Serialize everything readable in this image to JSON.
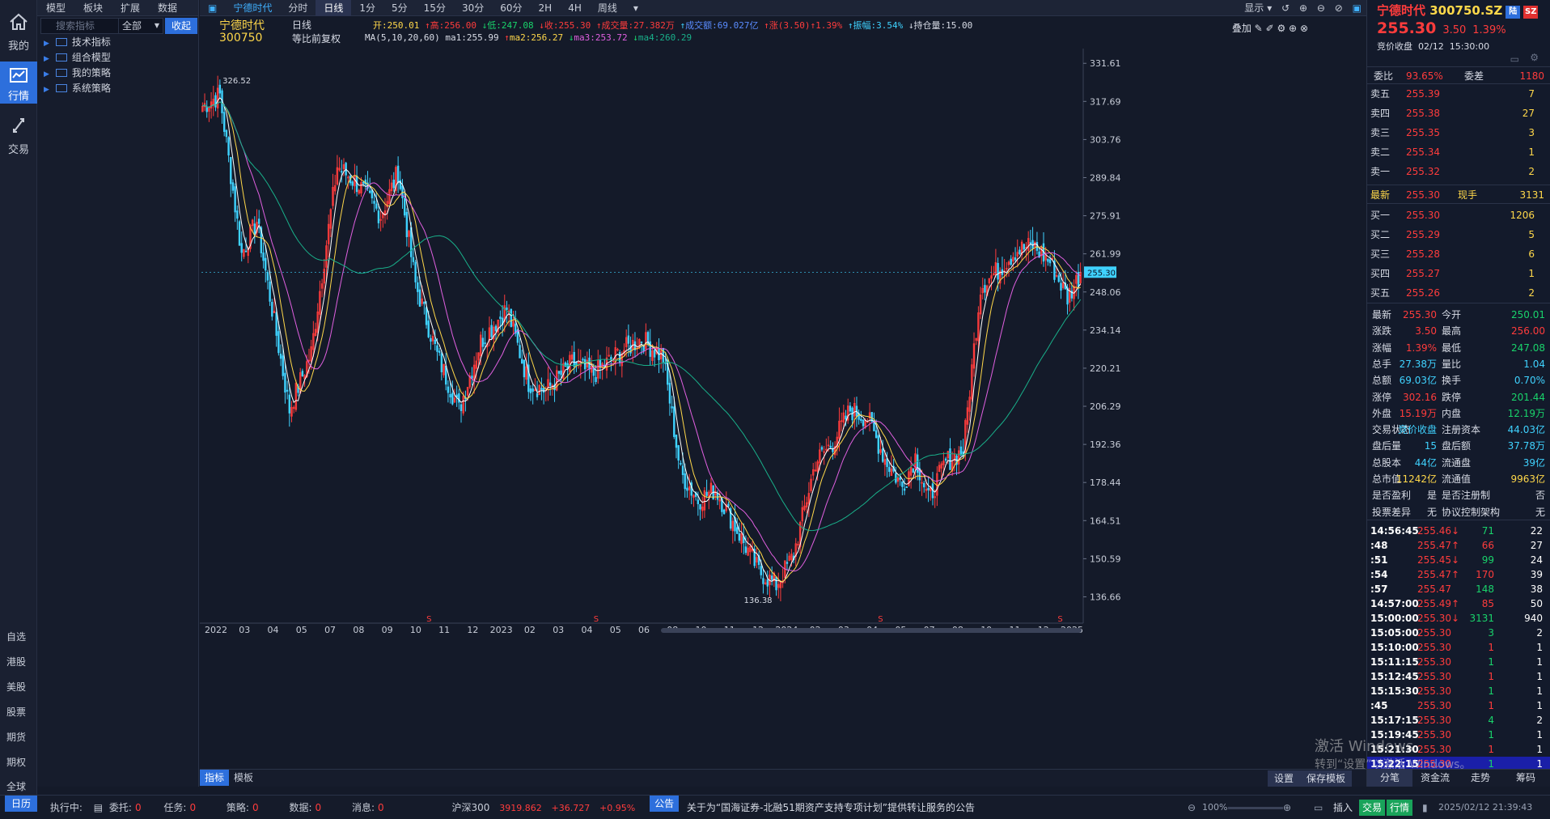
{
  "colors": {
    "bg": "#141a29",
    "up": "#ff3c3c",
    "down": "#19d36b",
    "accent": "#2d6fdc",
    "ma1": "#ffffff",
    "ma2": "#ffd84a",
    "ma3": "#e060e0",
    "ma4": "#19b08a"
  },
  "left_nav": {
    "items": [
      {
        "label": "我的",
        "icon": "home-icon"
      },
      {
        "label": "行情",
        "icon": "chart-icon"
      },
      {
        "label": "交易",
        "icon": "trade-icon"
      }
    ],
    "bottom": [
      "自选",
      "港股",
      "美股",
      "股票",
      "期货",
      "期权",
      "全球"
    ]
  },
  "tree": {
    "tabs": [
      "模型",
      "板块",
      "扩展",
      "数据"
    ],
    "search_placeholder": "搜索指标",
    "select_value": "全部",
    "collapse_label": "收起",
    "items": [
      "技术指标",
      "组合模型",
      "我的策略",
      "系统策略"
    ]
  },
  "toolbar": {
    "stock": "宁德时代",
    "periods": [
      "分时",
      "日线",
      "1分",
      "5分",
      "15分",
      "30分",
      "60分",
      "2H",
      "4H",
      "周线"
    ],
    "active_period": "日线",
    "display": "显示"
  },
  "header": {
    "name": "宁德时代",
    "code": "300750",
    "period": "日线",
    "adjust": "等比前复权",
    "overlay": "叠加",
    "ohlc": {
      "open_label": "开:",
      "open": "250.01",
      "high_label": "高:",
      "high": "256.00",
      "low_label": "低:",
      "low": "247.08",
      "close_label": "收:",
      "close": "255.30",
      "vol_label": "成交量:",
      "vol": "27.382万",
      "amt_label": "成交额:",
      "amt": "69.027亿",
      "chg_label": "涨(3.50)",
      "chg_pct": "1.39%",
      "amp_label": "振幅:",
      "amp": "3.54%",
      "oi_label": "持仓量:",
      "oi": "15.00"
    },
    "ma": {
      "params": "MA(5,10,20,60)",
      "ma1_label": "ma1:",
      "ma1": "255.99",
      "ma2_label": "ma2:",
      "ma2": "256.27",
      "ma3_label": "ma3:",
      "ma3": "253.72",
      "ma4_label": "ma4:",
      "ma4": "260.29"
    }
  },
  "chart_data": {
    "type": "candlestick",
    "title": "宁德时代 300750 日线",
    "ylim": [
      130,
      337
    ],
    "y_ticks": [
      "331.61",
      "317.69",
      "303.76",
      "289.84",
      "275.91",
      "261.99",
      "248.06",
      "234.14",
      "220.21",
      "206.29",
      "192.36",
      "178.44",
      "164.51",
      "150.59",
      "136.66"
    ],
    "current_price_tag": "255.30",
    "annotations": [
      {
        "label": "326.52",
        "note": "max"
      },
      {
        "label": "136.38",
        "note": "min"
      }
    ],
    "x_ticks": [
      "2022",
      "03",
      "04",
      "05",
      "07",
      "08",
      "09",
      "10",
      "11",
      "12",
      "2023",
      "02",
      "03",
      "04",
      "05",
      "06",
      "08",
      "10",
      "11",
      "12",
      "2024",
      "02",
      "03",
      "04",
      "05",
      "07",
      "08",
      "10",
      "11",
      "12",
      "2025"
    ],
    "s_markers": [
      "S",
      "S",
      "S",
      "S"
    ],
    "price_path": [
      {
        "i": 0,
        "v": 316
      },
      {
        "i": 8,
        "v": 320
      },
      {
        "i": 18,
        "v": 262
      },
      {
        "i": 25,
        "v": 274
      },
      {
        "i": 40,
        "v": 205
      },
      {
        "i": 50,
        "v": 226
      },
      {
        "i": 62,
        "v": 294
      },
      {
        "i": 72,
        "v": 287
      },
      {
        "i": 82,
        "v": 276
      },
      {
        "i": 90,
        "v": 292
      },
      {
        "i": 98,
        "v": 251
      },
      {
        "i": 108,
        "v": 225
      },
      {
        "i": 118,
        "v": 205
      },
      {
        "i": 128,
        "v": 230
      },
      {
        "i": 140,
        "v": 242
      },
      {
        "i": 150,
        "v": 215
      },
      {
        "i": 158,
        "v": 212
      },
      {
        "i": 170,
        "v": 222
      },
      {
        "i": 180,
        "v": 218
      },
      {
        "i": 192,
        "v": 226
      },
      {
        "i": 202,
        "v": 231
      },
      {
        "i": 212,
        "v": 224
      },
      {
        "i": 220,
        "v": 182
      },
      {
        "i": 228,
        "v": 172
      },
      {
        "i": 236,
        "v": 176
      },
      {
        "i": 248,
        "v": 158
      },
      {
        "i": 256,
        "v": 146
      },
      {
        "i": 264,
        "v": 141
      },
      {
        "i": 272,
        "v": 152
      },
      {
        "i": 282,
        "v": 186
      },
      {
        "i": 290,
        "v": 193
      },
      {
        "i": 298,
        "v": 205
      },
      {
        "i": 306,
        "v": 202
      },
      {
        "i": 314,
        "v": 187
      },
      {
        "i": 322,
        "v": 177
      },
      {
        "i": 328,
        "v": 188
      },
      {
        "i": 334,
        "v": 172
      },
      {
        "i": 342,
        "v": 186
      },
      {
        "i": 350,
        "v": 190
      },
      {
        "i": 358,
        "v": 250
      },
      {
        "i": 366,
        "v": 256
      },
      {
        "i": 374,
        "v": 263
      },
      {
        "i": 382,
        "v": 265
      },
      {
        "i": 390,
        "v": 259
      },
      {
        "i": 398,
        "v": 246
      },
      {
        "i": 404,
        "v": 255
      }
    ]
  },
  "bottom_bar": {
    "tabs": [
      "指标",
      "模板"
    ],
    "settings": "设置",
    "save_template": "保存模板"
  },
  "right_panel": {
    "title": "宁德时代",
    "code": "300750.SZ",
    "badge1": "陆",
    "badge2": "SZ",
    "price": "255.30",
    "chg": "3.50",
    "pct": "1.39%",
    "status": "竞价收盘",
    "date": "02/12",
    "time": "15:30:00",
    "weibi_label": "委比",
    "weibi": "93.65%",
    "weicha_label": "委差",
    "weicha": "1180",
    "asks": [
      {
        "label": "卖五",
        "price": "255.39",
        "vol": "7"
      },
      {
        "label": "卖四",
        "price": "255.38",
        "vol": "27"
      },
      {
        "label": "卖三",
        "price": "255.35",
        "vol": "3"
      },
      {
        "label": "卖二",
        "price": "255.34",
        "vol": "1"
      },
      {
        "label": "卖一",
        "price": "255.32",
        "vol": "2"
      }
    ],
    "latest": {
      "label": "最新",
      "price": "255.30",
      "hand_label": "现手",
      "hand": "3131"
    },
    "bids": [
      {
        "label": "买一",
        "price": "255.30",
        "vol": "1206"
      },
      {
        "label": "买二",
        "price": "255.29",
        "vol": "5"
      },
      {
        "label": "买三",
        "price": "255.28",
        "vol": "6"
      },
      {
        "label": "买四",
        "price": "255.27",
        "vol": "1"
      },
      {
        "label": "买五",
        "price": "255.26",
        "vol": "2"
      }
    ],
    "stats": [
      {
        "k": "最新",
        "v": "255.30",
        "c": "red"
      },
      {
        "k": "今开",
        "v": "250.01",
        "c": "grn"
      },
      {
        "k": "涨跌",
        "v": "3.50",
        "c": "red"
      },
      {
        "k": "最高",
        "v": "256.00",
        "c": "red"
      },
      {
        "k": "涨幅",
        "v": "1.39%",
        "c": "red"
      },
      {
        "k": "最低",
        "v": "247.08",
        "c": "grn"
      },
      {
        "k": "总手",
        "v": "27.38万",
        "c": "cyan"
      },
      {
        "k": "量比",
        "v": "1.04",
        "c": "cyan"
      },
      {
        "k": "总额",
        "v": "69.03亿",
        "c": "cyan"
      },
      {
        "k": "换手",
        "v": "0.70%",
        "c": "cyan"
      },
      {
        "k": "涨停",
        "v": "302.16",
        "c": "red"
      },
      {
        "k": "跌停",
        "v": "201.44",
        "c": "grn"
      },
      {
        "k": "外盘",
        "v": "15.19万",
        "c": "red"
      },
      {
        "k": "内盘",
        "v": "12.19万",
        "c": "grn"
      },
      {
        "k": "交易状态",
        "v": "竞价收盘",
        "c": "cyan"
      },
      {
        "k": "注册资本",
        "v": "44.03亿",
        "c": "cyan"
      },
      {
        "k": "盘后量",
        "v": "15",
        "c": "cyan"
      },
      {
        "k": "盘后额",
        "v": "37.78万",
        "c": "cyan"
      },
      {
        "k": "总股本",
        "v": "44亿",
        "c": "cyan"
      },
      {
        "k": "流通盘",
        "v": "39亿",
        "c": "cyan"
      },
      {
        "k": "总市值",
        "v": "11242亿",
        "c": "yel"
      },
      {
        "k": "流通值",
        "v": "9963亿",
        "c": "yel"
      },
      {
        "k": "是否盈利",
        "v": "是",
        "c": "wht"
      },
      {
        "k": "是否注册制",
        "v": "否",
        "c": "wht"
      },
      {
        "k": "投票差异",
        "v": "无",
        "c": "wht"
      },
      {
        "k": "协议控制架构",
        "v": "无",
        "c": "wht"
      }
    ],
    "ticks": [
      {
        "t": "14:56:45",
        "p": "255.46",
        "d": "↓",
        "v": "71",
        "vc": "grn",
        "n": "22"
      },
      {
        "t": ":48",
        "p": "255.47",
        "d": "↑",
        "v": "66",
        "vc": "red",
        "n": "27"
      },
      {
        "t": ":51",
        "p": "255.45",
        "d": "↓",
        "v": "99",
        "vc": "grn",
        "n": "24"
      },
      {
        "t": ":54",
        "p": "255.47",
        "d": "↑",
        "v": "170",
        "vc": "red",
        "n": "39"
      },
      {
        "t": ":57",
        "p": "255.47",
        "d": "",
        "v": "148",
        "vc": "grn",
        "n": "38"
      },
      {
        "t": "14:57:00",
        "p": "255.49",
        "d": "↑",
        "v": "85",
        "vc": "red",
        "n": "50"
      },
      {
        "t": "15:00:00",
        "p": "255.30",
        "d": "↓",
        "v": "3131",
        "vc": "grn",
        "n": "940"
      },
      {
        "t": "15:05:00",
        "p": "255.30",
        "d": "",
        "v": "3",
        "vc": "grn",
        "n": "2"
      },
      {
        "t": "15:10:00",
        "p": "255.30",
        "d": "",
        "v": "1",
        "vc": "red",
        "n": "1"
      },
      {
        "t": "15:11:15",
        "p": "255.30",
        "d": "",
        "v": "1",
        "vc": "grn",
        "n": "1"
      },
      {
        "t": "15:12:45",
        "p": "255.30",
        "d": "",
        "v": "1",
        "vc": "red",
        "n": "1"
      },
      {
        "t": "15:15:30",
        "p": "255.30",
        "d": "",
        "v": "1",
        "vc": "grn",
        "n": "1"
      },
      {
        "t": ":45",
        "p": "255.30",
        "d": "",
        "v": "1",
        "vc": "red",
        "n": "1"
      },
      {
        "t": "15:17:15",
        "p": "255.30",
        "d": "",
        "v": "4",
        "vc": "grn",
        "n": "2"
      },
      {
        "t": "15:19:45",
        "p": "255.30",
        "d": "",
        "v": "1",
        "vc": "grn",
        "n": "1"
      },
      {
        "t": "15:21:30",
        "p": "255.30",
        "d": "",
        "v": "1",
        "vc": "red",
        "n": "1"
      },
      {
        "t": "15:22:15",
        "p": "255.30",
        "d": "",
        "v": "1",
        "vc": "grn",
        "n": "1"
      }
    ],
    "bottom_tabs": [
      "分笔",
      "资金流",
      "走势",
      "筹码"
    ]
  },
  "status_bar": {
    "calendar": "日历",
    "running": "执行中:",
    "entrust": "委托:",
    "entrust_v": "0",
    "task": "任务:",
    "task_v": "0",
    "strategy": "策略:",
    "strategy_v": "0",
    "data": "数据:",
    "data_v": "0",
    "msg": "消息:",
    "msg_v": "0",
    "index": "沪深300",
    "index_v": "3919.862",
    "index_chg": "+36.727",
    "index_pct": "+0.95%",
    "notice_tag": "公告",
    "notice": "关于为“国海证券-北融51期资产支持专项计划”提供转让服务的公告",
    "zoom": "100%",
    "insert": "插入",
    "trade": "交易",
    "quote": "行情",
    "datetime": "2025/02/12 21:39:43"
  },
  "watermark": {
    "line1": "激活 Windows",
    "line2": "转到“设置”以激活 Windows。"
  }
}
